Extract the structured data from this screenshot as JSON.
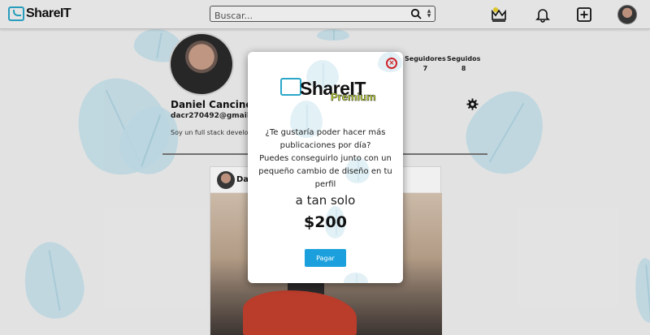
{
  "header": {
    "logo_text": "ShareIT",
    "search": {
      "placeholder": "Buscar..."
    },
    "icons": [
      "premium-crown-icon",
      "notification-bell-icon",
      "add-post-icon",
      "user-avatar"
    ]
  },
  "profile": {
    "name": "Daniel Cancino",
    "email": "dacr270492@gmail.com",
    "bio": "Soy un full stack developer ... proactividad y seguir ap...",
    "stats": [
      {
        "label": "Seguidores",
        "value": "7"
      },
      {
        "label": "Seguidos",
        "value": "8"
      }
    ]
  },
  "post": {
    "username": "Dani"
  },
  "modal": {
    "logo_text": "ShareIT",
    "logo_subtitle": "Premium",
    "question": "¿Te gustaría poder hacer más publicaciones por día?",
    "description": "Puedes conseguirlo junto con un pequeño cambio de diseño en tu perfil",
    "tagline": "a tan solo",
    "price": "$200",
    "pay_label": "Pagar",
    "close_icon": "close-icon"
  },
  "colors": {
    "accent": "#1ca0dd",
    "brand": "#2aa7c9",
    "close": "#d0232a",
    "premium": "#d9f23a"
  }
}
